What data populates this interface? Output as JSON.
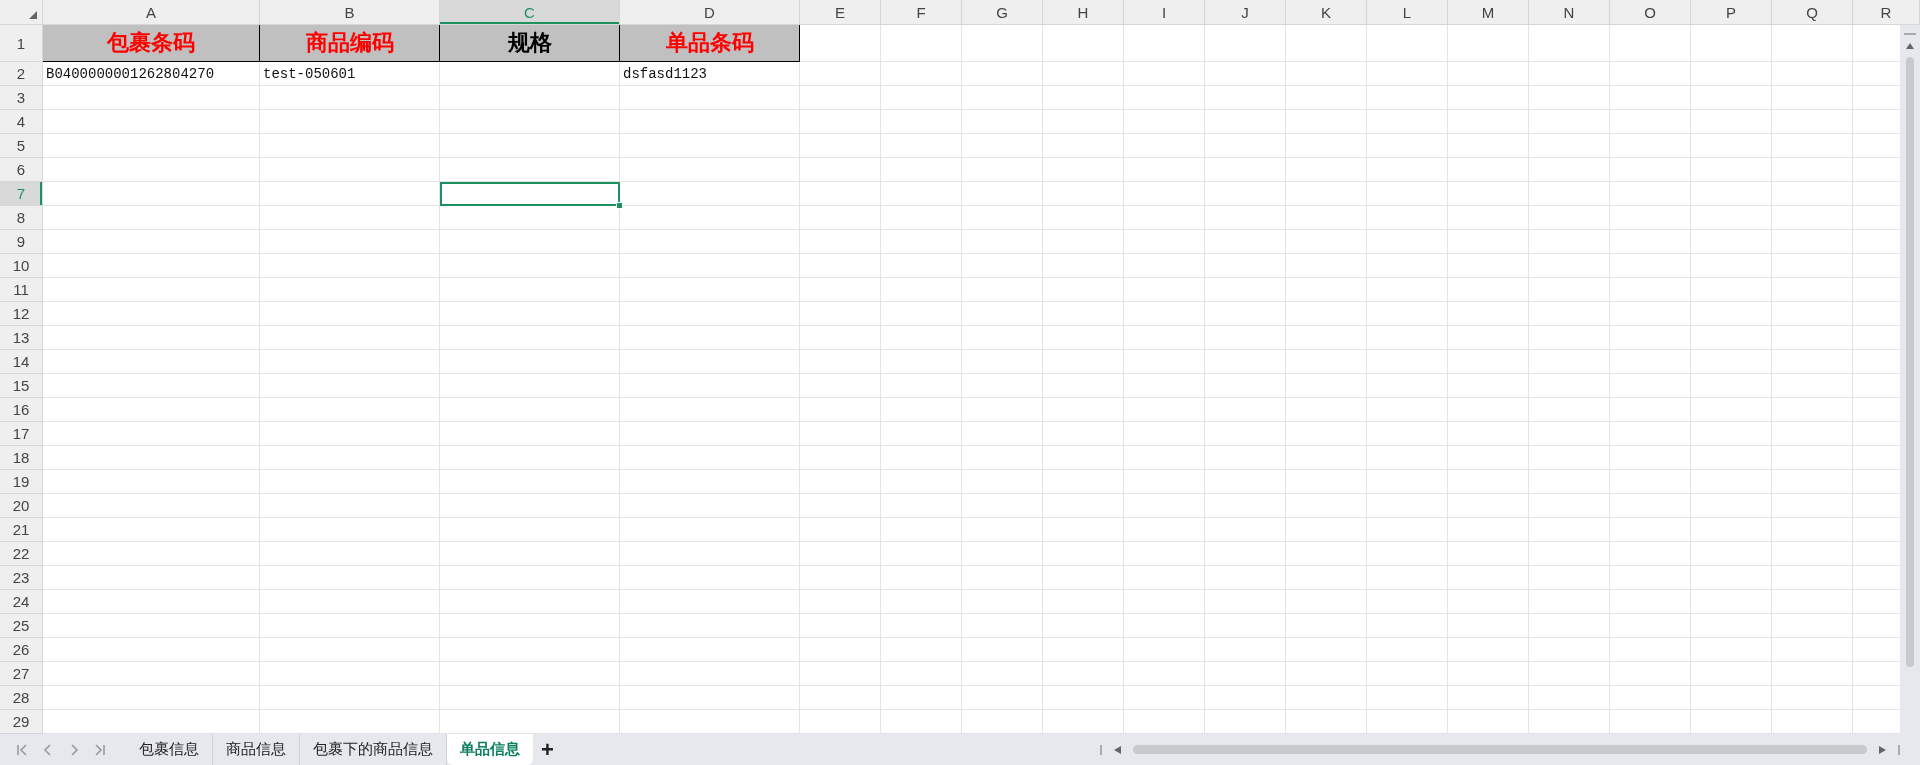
{
  "columns": [
    {
      "label": "A",
      "selected": false
    },
    {
      "label": "B",
      "selected": false
    },
    {
      "label": "C",
      "selected": true
    },
    {
      "label": "D",
      "selected": false
    },
    {
      "label": "E",
      "selected": false
    },
    {
      "label": "F",
      "selected": false
    },
    {
      "label": "G",
      "selected": false
    },
    {
      "label": "H",
      "selected": false
    },
    {
      "label": "I",
      "selected": false
    },
    {
      "label": "J",
      "selected": false
    },
    {
      "label": "K",
      "selected": false
    },
    {
      "label": "L",
      "selected": false
    },
    {
      "label": "M",
      "selected": false
    },
    {
      "label": "N",
      "selected": false
    },
    {
      "label": "O",
      "selected": false
    },
    {
      "label": "P",
      "selected": false
    },
    {
      "label": "Q",
      "selected": false
    },
    {
      "label": "R",
      "selected": false
    }
  ],
  "rows": [
    {
      "label": "1",
      "selected": false,
      "kind": "header",
      "cells": [
        {
          "text": "包裹条码",
          "color": "#ff0000"
        },
        {
          "text": "商品编码",
          "color": "#ff0000"
        },
        {
          "text": "规格",
          "color": "#000000"
        },
        {
          "text": "单品条码",
          "color": "#ff0000"
        }
      ]
    },
    {
      "label": "2",
      "selected": false,
      "kind": "data",
      "cells": [
        {
          "text": "B0400000001262804270"
        },
        {
          "text": "test-050601"
        },
        null,
        {
          "text": "dsfasd1123"
        }
      ]
    },
    {
      "label": "3",
      "selected": false
    },
    {
      "label": "4",
      "selected": false
    },
    {
      "label": "5",
      "selected": false
    },
    {
      "label": "6",
      "selected": false
    },
    {
      "label": "7",
      "selected": true
    },
    {
      "label": "8",
      "selected": false
    },
    {
      "label": "9",
      "selected": false
    },
    {
      "label": "10",
      "selected": false
    },
    {
      "label": "11",
      "selected": false
    },
    {
      "label": "12",
      "selected": false
    },
    {
      "label": "13",
      "selected": false
    },
    {
      "label": "14",
      "selected": false
    },
    {
      "label": "15",
      "selected": false
    },
    {
      "label": "16",
      "selected": false
    },
    {
      "label": "17",
      "selected": false
    },
    {
      "label": "18",
      "selected": false
    },
    {
      "label": "19",
      "selected": false
    },
    {
      "label": "20",
      "selected": false
    },
    {
      "label": "21",
      "selected": false
    },
    {
      "label": "22",
      "selected": false
    },
    {
      "label": "23",
      "selected": false
    },
    {
      "label": "24",
      "selected": false
    },
    {
      "label": "25",
      "selected": false
    },
    {
      "label": "26",
      "selected": false
    },
    {
      "label": "27",
      "selected": false
    },
    {
      "label": "28",
      "selected": false
    },
    {
      "label": "29",
      "selected": false
    }
  ],
  "sheet_tabs": [
    {
      "label": "包裹信息",
      "selected": false
    },
    {
      "label": "商品信息",
      "selected": false
    },
    {
      "label": "包裹下的商品信息",
      "selected": false
    },
    {
      "label": "单品信息",
      "selected": true
    }
  ],
  "add_sheet": "+"
}
